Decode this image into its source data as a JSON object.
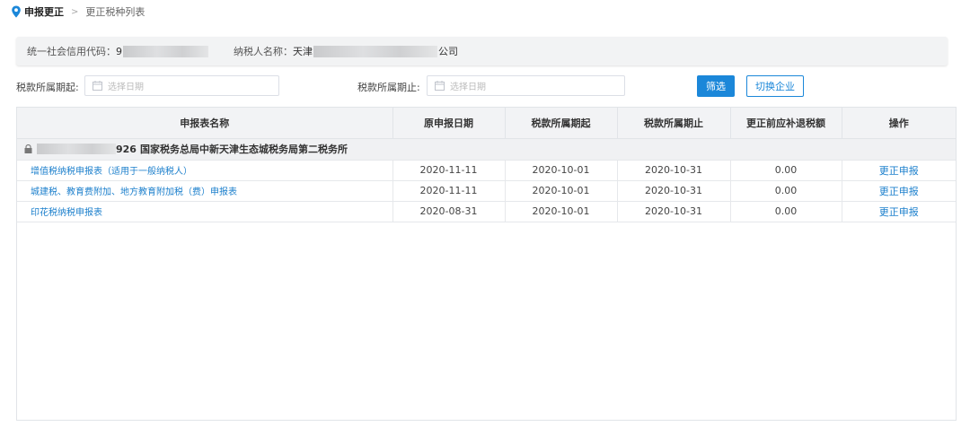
{
  "breadcrumb": {
    "current": "申报更正",
    "separator": ">",
    "page": "更正税种列表"
  },
  "info": {
    "credit_code_label": "统一社会信用代码：",
    "credit_code_visible": "9",
    "taxpayer_label": "纳税人名称：",
    "taxpayer_prefix": "天津",
    "taxpayer_suffix": "公司"
  },
  "filter": {
    "start_label": "税款所属期起:",
    "end_label": "税款所属期止:",
    "start_placeholder": "选择日期",
    "end_placeholder": "选择日期",
    "filter_button": "筛选",
    "switch_button": "切换企业"
  },
  "table": {
    "columns": [
      "申报表名称",
      "原申报日期",
      "税款所属期起",
      "税款所属期止",
      "更正前应补退税额",
      "操作"
    ],
    "group": {
      "code_suffix": "926",
      "office": "国家税务总局中新天津生态城税务局第二税务所"
    },
    "rows": [
      {
        "name": "增值税纳税申报表（适用于一般纳税人）",
        "orig_date": "2020-11-11",
        "start": "2020-10-01",
        "end": "2020-10-31",
        "amount": "0.00",
        "action": "更正申报"
      },
      {
        "name": "城建税、教育费附加、地方教育附加税（费）申报表",
        "orig_date": "2020-11-11",
        "start": "2020-10-01",
        "end": "2020-10-31",
        "amount": "0.00",
        "action": "更正申报"
      },
      {
        "name": "印花税纳税申报表",
        "orig_date": "2020-08-31",
        "start": "2020-10-01",
        "end": "2020-10-31",
        "amount": "0.00",
        "action": "更正申报"
      }
    ]
  },
  "icons": {
    "breadcrumb": "location-pin-icon",
    "date": "calendar-icon",
    "group": "lock-icon"
  },
  "colors": {
    "primary": "#1b87d9",
    "link": "#1b7fcc",
    "header_bg": "#f2f3f5"
  }
}
